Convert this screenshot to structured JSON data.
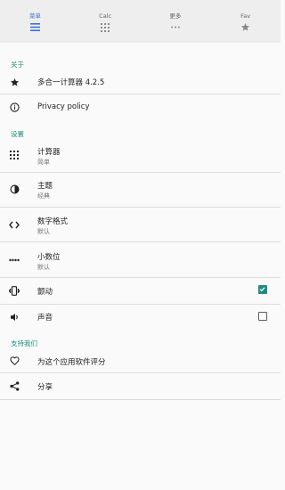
{
  "tabs": [
    {
      "label": "菜单",
      "icon": "menu-icon"
    },
    {
      "label": "Calc",
      "icon": "calculator-grid-icon"
    },
    {
      "label": "更多",
      "icon": "more-dots-icon"
    },
    {
      "label": "Fav",
      "icon": "star-icon"
    }
  ],
  "sections": {
    "about": "关于",
    "settings": "设置",
    "support": "支持我们"
  },
  "about_items": {
    "app_name": "多合一计算器 4.2.5",
    "privacy": "Privacy policy"
  },
  "settings_items": {
    "calculator": {
      "title": "计算器",
      "subtitle": "简单"
    },
    "theme": {
      "title": "主题",
      "subtitle": "经典"
    },
    "number_format": {
      "title": "数字格式",
      "subtitle": "默认"
    },
    "decimals": {
      "title": "小数位",
      "subtitle": "默认"
    },
    "vibration": {
      "title": "颤动",
      "checked": true
    },
    "sound": {
      "title": "声音",
      "checked": false
    }
  },
  "support_items": {
    "rate": "为这个应用软件评分",
    "share": "分享"
  },
  "colors": {
    "accent": "#1e8e7e",
    "active_tab": "#3f6fd1",
    "tabbar_bg": "#eeeeee"
  }
}
